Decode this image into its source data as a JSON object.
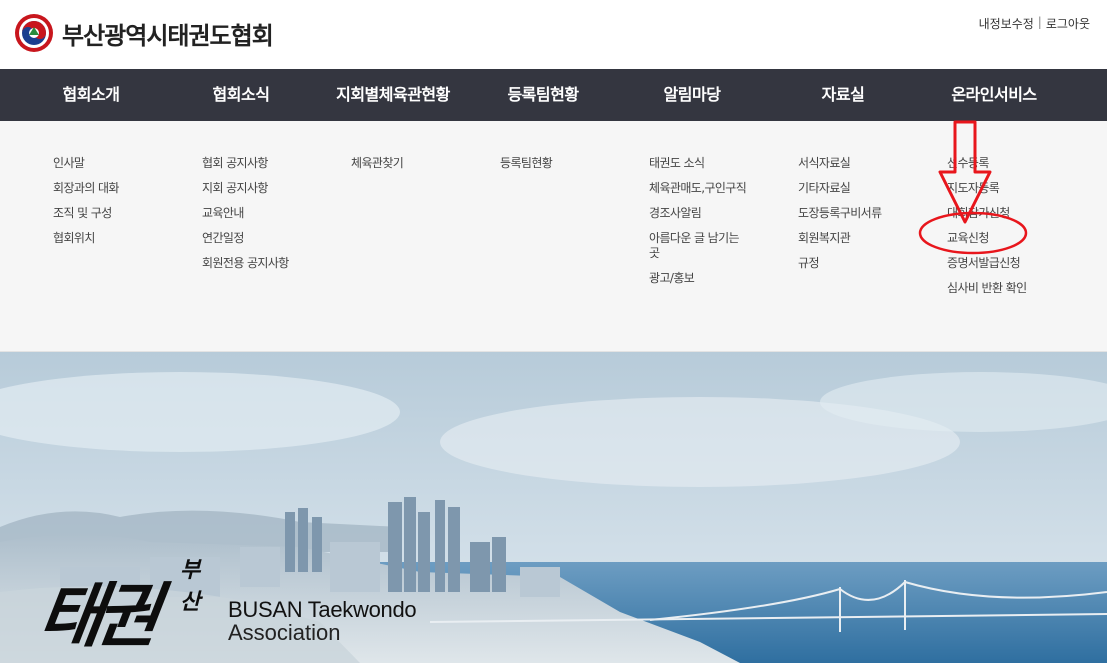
{
  "header": {
    "site_title": "부산광역시태권도협회",
    "util_links": [
      "내정보수정",
      "로그아웃"
    ],
    "util_separator": "|"
  },
  "gnb": {
    "items": [
      {
        "label": "협회소개"
      },
      {
        "label": "협회소식"
      },
      {
        "label": "지회별체육관현황"
      },
      {
        "label": "등록팀현황"
      },
      {
        "label": "알림마당"
      },
      {
        "label": "자료실"
      },
      {
        "label": "온라인서비스"
      }
    ]
  },
  "submenu": {
    "col1": [
      "인사말",
      "회장과의 대화",
      "조직 및 구성",
      "협회위치"
    ],
    "col2": [
      "협회 공지사항",
      "지회 공지사항",
      "교육안내",
      "연간일정",
      "회원전용 공지사항"
    ],
    "col3": [
      "체육관찾기"
    ],
    "col4": [
      "등록팀현황"
    ],
    "col5": [
      "태권도 소식",
      "체육관매도,구인구직",
      "경조사알림",
      "아름다운 글 남기는 곳",
      "광고/홍보"
    ],
    "col6": [
      "서식자료실",
      "기타자료실",
      "도장등록구비서류",
      "회원복지관",
      "규정"
    ],
    "col7": [
      "선수등록",
      "지도자등록",
      "대회참가신청",
      "교육신청",
      "증명서발급신청",
      "심사비 반환 확인"
    ]
  },
  "hero": {
    "calligraphy": "태권",
    "calligraphy_small": "부산",
    "title_line1": "BUSAN Taekwondo",
    "title_line2": "Association"
  },
  "colors": {
    "nav_bg": "#343640",
    "dropdown_bg": "#f6f6f6",
    "annotation_red": "#e8161c"
  },
  "icons": {
    "logo": "taekwondo-emblem-icon",
    "arrow": "down-arrow-annotation",
    "circle": "ellipse-annotation"
  }
}
